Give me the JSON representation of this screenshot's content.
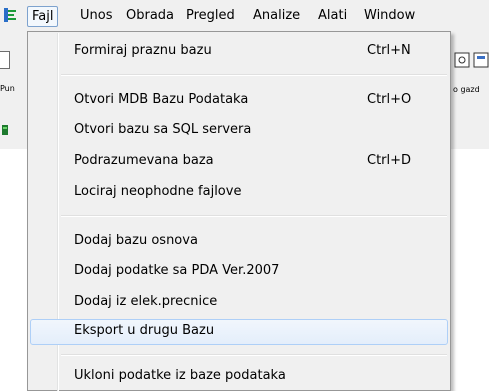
{
  "menubar": {
    "items": [
      "Fajl",
      "Unos",
      "Obrada",
      "Pregled",
      "Analize",
      "Alati",
      "Window"
    ],
    "active": "Fajl"
  },
  "background": {
    "left_label": "Pun",
    "right_label": "o gazd"
  },
  "dropdown": {
    "items": [
      {
        "label": "Formiraj praznu bazu",
        "shortcut": "Ctrl+N"
      },
      {
        "label": "Otvori MDB Bazu Podataka",
        "shortcut": "Ctrl+O"
      },
      {
        "label": "Otvori bazu sa SQL servera",
        "shortcut": ""
      },
      {
        "label": "Podrazumevana baza",
        "shortcut": "Ctrl+D"
      },
      {
        "label": "Lociraj neophodne fajlove",
        "shortcut": ""
      },
      {
        "label": "Dodaj bazu osnova",
        "shortcut": ""
      },
      {
        "label": "Dodaj podatke sa PDA Ver.2007",
        "shortcut": ""
      },
      {
        "label": "Dodaj iz elek.precnice",
        "shortcut": ""
      },
      {
        "label": "Eksport u  drugu Bazu",
        "shortcut": ""
      },
      {
        "label": "Ukloni podatke iz baze podataka",
        "shortcut": ""
      }
    ],
    "highlighted": "Eksport u  drugu Bazu"
  }
}
